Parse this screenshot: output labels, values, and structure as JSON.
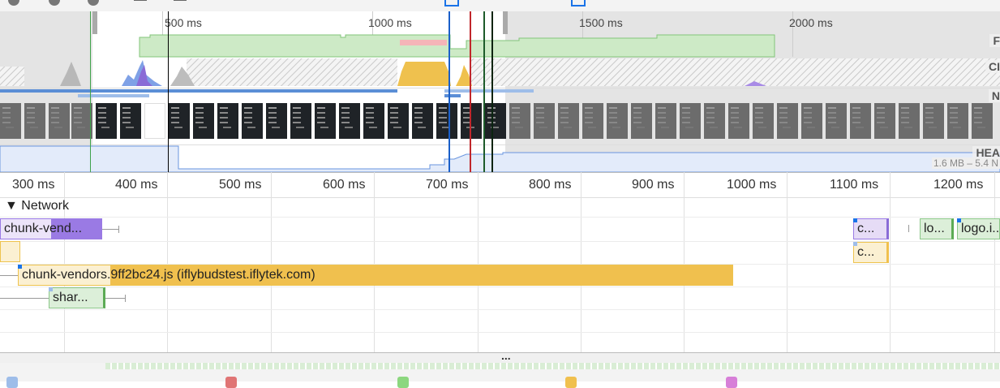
{
  "overview": {
    "ticks": [
      "500 ms",
      "1000 ms",
      "1500 ms",
      "2000 ms"
    ],
    "tracks": [
      "F",
      "CI",
      "N",
      "HEA"
    ],
    "heap_range": "1.6 MB – 5.4 N"
  },
  "ruler": {
    "ticks": [
      "300 ms",
      "400 ms",
      "500 ms",
      "600 ms",
      "700 ms",
      "800 ms",
      "900 ms",
      "1000 ms",
      "1100 ms",
      "1200 ms"
    ]
  },
  "network": {
    "section_label": "Network",
    "expand_glyph": "▼",
    "requests": [
      {
        "label": "chunk-vend...",
        "type": "script-purple"
      },
      {
        "label": "chunk-vendors.9ff2bc24.js (iflybudstest.iflytek.com)",
        "type": "script-yellow"
      },
      {
        "label": "shar...",
        "type": "image-green"
      },
      {
        "label": "c...",
        "type": "script-purple"
      },
      {
        "label": "c...",
        "type": "script-yellow"
      },
      {
        "label": "lo...",
        "type": "image-green"
      },
      {
        "label": "logo.i...",
        "type": "image-green"
      }
    ]
  },
  "splitter": {
    "grip": "..."
  },
  "colors": {
    "script": "#f0c04e",
    "stylesheet": "#9a7ae4",
    "image": "#8cc789",
    "marker_blue": "#1a5fc9",
    "marker_red": "#c0262b",
    "marker_green": "#1d5b2a"
  }
}
